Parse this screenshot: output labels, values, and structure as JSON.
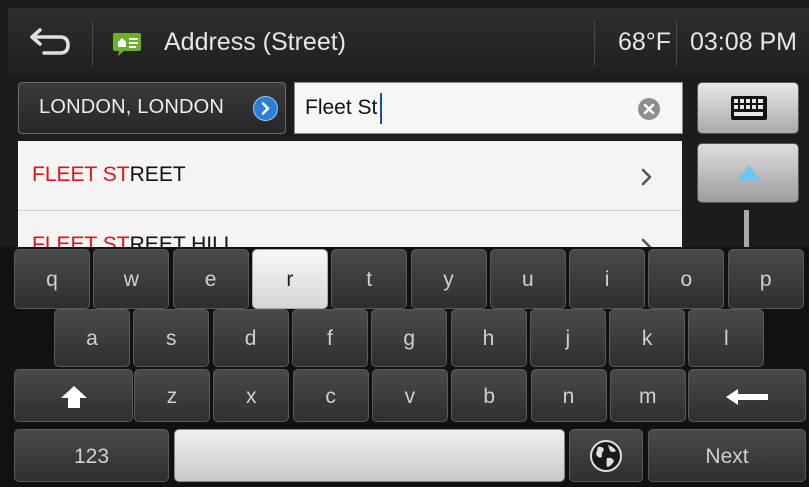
{
  "header": {
    "title": "Address (Street)",
    "temperature": "68°F",
    "time": "03:08 PM"
  },
  "search": {
    "city": "LONDON, LONDON",
    "query": "Fleet St"
  },
  "results": [
    {
      "match": "FLEET ST",
      "rest": "REET"
    },
    {
      "match": "FLEET ST",
      "rest": "REET HILL"
    }
  ],
  "keyboard": {
    "row1": [
      "q",
      "w",
      "e",
      "r",
      "t",
      "y",
      "u",
      "i",
      "o",
      "p"
    ],
    "row2": [
      "a",
      "s",
      "d",
      "f",
      "g",
      "h",
      "j",
      "k",
      "l"
    ],
    "row3": [
      "z",
      "x",
      "c",
      "v",
      "b",
      "n",
      "m"
    ],
    "numbers_label": "123",
    "next_label": "Next",
    "pressed_key": "r"
  },
  "colors": {
    "match_highlight": "#d8161b",
    "go_icon": "#2a7fd8",
    "scroll_arrow": "#6ec3ef"
  }
}
